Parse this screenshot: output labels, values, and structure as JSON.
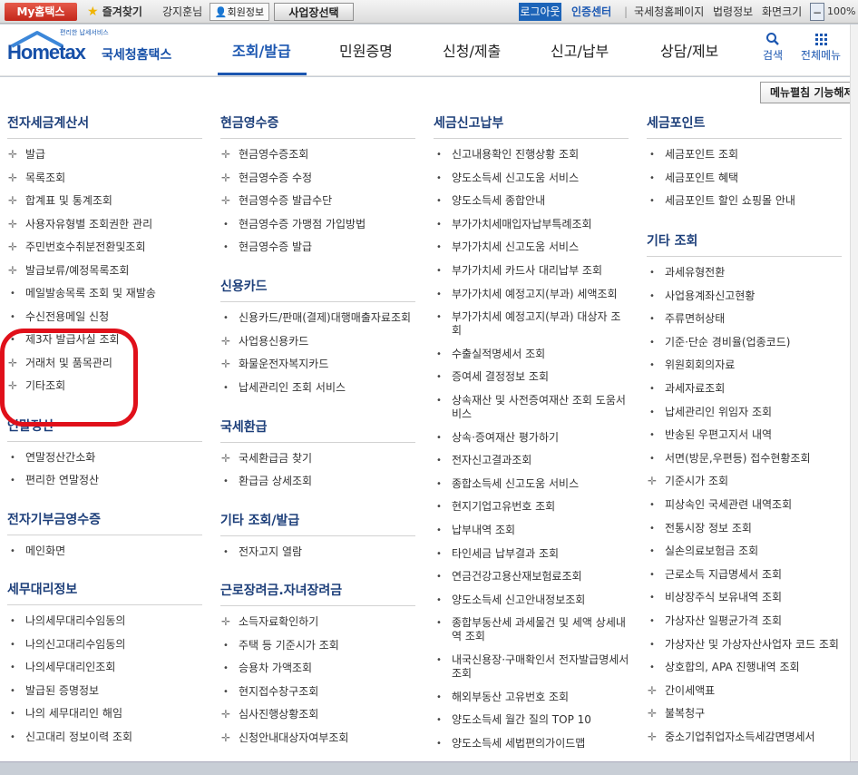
{
  "topbar": {
    "my_hometax": "My홈택스",
    "favorites": "즐겨찾기",
    "user_name": "강지훈님",
    "member_info": "회원정보",
    "business_select": "사업장선택",
    "logout": "로그아웃",
    "cert_center": "인증센터",
    "hometax_page": "국세청홈페이지",
    "law_info": "법령정보",
    "screen_size": "화면크기",
    "zoom_minus": "−",
    "zoom": "100%"
  },
  "header": {
    "logo_sub": "편리한 납세서비스",
    "logo_text": "Hometax",
    "logo_nts": "국세청홈택스",
    "gnb": [
      "조회/발급",
      "민원증명",
      "신청/제출",
      "신고/납부",
      "상담/제보"
    ],
    "active_gnb": "조회/발급",
    "search_label": "검색",
    "all_menu_label": "전체메뉴",
    "brand_color": "#1750a8"
  },
  "panel": {
    "collapse_label": "메뉴펼침 기능해제",
    "sections": [
      {
        "title": "전자세금계산서",
        "items": [
          {
            "label": "발급",
            "expand": true
          },
          {
            "label": "목록조회",
            "expand": true
          },
          {
            "label": "합계표 및 통계조회",
            "expand": true
          },
          {
            "label": "사용자유형별 조회권한 관리",
            "expand": true
          },
          {
            "label": "주민번호수취분전환및조회",
            "expand": true
          },
          {
            "label": "발급보류/예정목록조회",
            "expand": true
          },
          {
            "label": "메일발송목록 조회 및 재발송",
            "expand": false
          },
          {
            "label": "수신전용메일 신청",
            "expand": false
          },
          {
            "label": "제3자 발급사실 조회",
            "expand": false
          },
          {
            "label": "거래처 및 품목관리",
            "expand": true
          },
          {
            "label": "기타조회",
            "expand": true
          }
        ]
      },
      {
        "title": "연말정산",
        "items": [
          {
            "label": "연말정산간소화",
            "expand": false
          },
          {
            "label": "편리한 연말정산",
            "expand": false
          }
        ]
      },
      {
        "title": "전자기부금영수증",
        "items": [
          {
            "label": "메인화면",
            "expand": false
          }
        ]
      },
      {
        "title": "세무대리정보",
        "items": [
          {
            "label": "나의세무대리수임동의",
            "expand": false
          },
          {
            "label": "나의신고대리수임동의",
            "expand": false
          },
          {
            "label": "나의세무대리인조회",
            "expand": false
          },
          {
            "label": "발급된 증명정보",
            "expand": false
          },
          {
            "label": "나의 세무대리인 해임",
            "expand": false
          },
          {
            "label": "신고대리 정보이력 조회",
            "expand": false
          }
        ]
      },
      {
        "title": "현금영수증",
        "items": [
          {
            "label": "현금영수증조회",
            "expand": true
          },
          {
            "label": "현금영수증 수정",
            "expand": true
          },
          {
            "label": "현금영수증 발급수단",
            "expand": true
          },
          {
            "label": "현금영수증 가맹점 가입방법",
            "expand": false
          },
          {
            "label": "현금영수증 발급",
            "expand": false
          }
        ]
      },
      {
        "title": "신용카드",
        "items": [
          {
            "label": "신용카드/판매(결제)대행매출자료조회",
            "expand": false
          },
          {
            "label": "사업용신용카드",
            "expand": true
          },
          {
            "label": "화물운전자복지카드",
            "expand": true
          },
          {
            "label": "납세관리인 조회 서비스",
            "expand": false
          }
        ]
      },
      {
        "title": "국세환급",
        "items": [
          {
            "label": "국세환급금 찾기",
            "expand": true
          },
          {
            "label": "환급금 상세조회",
            "expand": false
          }
        ]
      },
      {
        "title": "기타 조회/발급",
        "items": [
          {
            "label": "전자고지 열람",
            "expand": false
          }
        ]
      },
      {
        "title": "근로장려금.자녀장려금",
        "items": [
          {
            "label": "소득자료확인하기",
            "expand": true
          },
          {
            "label": "주택 등 기준시가 조회",
            "expand": false
          },
          {
            "label": "승용차 가액조회",
            "expand": false
          },
          {
            "label": "현지접수창구조회",
            "expand": false
          },
          {
            "label": "심사진행상황조회",
            "expand": true
          },
          {
            "label": "신청안내대상자여부조회",
            "expand": true
          }
        ]
      },
      {
        "title": "세금신고납부",
        "items": [
          {
            "label": "신고내용확인 진행상황 조회",
            "expand": false
          },
          {
            "label": "양도소득세 신고도움 서비스",
            "expand": false
          },
          {
            "label": "양도소득세 종합안내",
            "expand": false
          },
          {
            "label": "부가가치세매입자납부특례조회",
            "expand": false
          },
          {
            "label": "부가가치세 신고도움 서비스",
            "expand": false
          },
          {
            "label": "부가가치세 카드사 대리납부 조회",
            "expand": false
          },
          {
            "label": "부가가치세 예정고지(부과) 세액조회",
            "expand": false
          },
          {
            "label": "부가가치세 예정고지(부과) 대상자 조회",
            "expand": false
          },
          {
            "label": "수출실적명세서 조회",
            "expand": false
          },
          {
            "label": "증여세 결정정보 조회",
            "expand": false
          },
          {
            "label": "상속재산 및 사전증여재산 조회 도움서비스",
            "expand": false
          },
          {
            "label": "상속·증여재산 평가하기",
            "expand": false
          },
          {
            "label": "전자신고결과조회",
            "expand": false
          },
          {
            "label": "종합소득세 신고도움 서비스",
            "expand": false
          },
          {
            "label": "현지기업고유번호 조회",
            "expand": false
          },
          {
            "label": "납부내역 조회",
            "expand": false
          },
          {
            "label": "타인세금 납부결과 조회",
            "expand": false
          },
          {
            "label": "연금건강고용산재보험료조회",
            "expand": false
          },
          {
            "label": "양도소득세 신고안내정보조회",
            "expand": false
          },
          {
            "label": "종합부동산세 과세물건 및 세액 상세내역 조회",
            "expand": false
          },
          {
            "label": "내국신용장·구매확인서 전자발급명세서 조회",
            "expand": false
          },
          {
            "label": "해외부동산 고유번호 조회",
            "expand": false
          },
          {
            "label": "양도소득세 월간 질의 TOP 10",
            "expand": false
          },
          {
            "label": "양도소득세 세법편의가이드맵",
            "expand": false
          }
        ]
      },
      {
        "title": "세금포인트",
        "items": [
          {
            "label": "세금포인트 조회",
            "expand": false
          },
          {
            "label": "세금포인트 혜택",
            "expand": false
          },
          {
            "label": "세금포인트 할인 쇼핑몰 안내",
            "expand": false
          }
        ]
      },
      {
        "title": "기타 조회",
        "items": [
          {
            "label": "과세유형전환",
            "expand": false
          },
          {
            "label": "사업용계좌신고현황",
            "expand": false
          },
          {
            "label": "주류면허상태",
            "expand": false
          },
          {
            "label": "기준·단순 경비율(업종코드)",
            "expand": false
          },
          {
            "label": "위원회회의자료",
            "expand": false
          },
          {
            "label": "과세자료조회",
            "expand": false
          },
          {
            "label": "납세관리인 위임자 조회",
            "expand": false
          },
          {
            "label": "반송된 우편고지서 내역",
            "expand": false
          },
          {
            "label": "서면(방문,우편등) 접수현황조회",
            "expand": false
          },
          {
            "label": "기준시가 조회",
            "expand": true
          },
          {
            "label": "피상속인 국세관련 내역조회",
            "expand": false
          },
          {
            "label": "전통시장 정보 조회",
            "expand": false
          },
          {
            "label": "실손의료보험금 조회",
            "expand": false
          },
          {
            "label": "근로소득 지급명세서 조회",
            "expand": false
          },
          {
            "label": "비상장주식 보유내역 조회",
            "expand": false
          },
          {
            "label": "가상자산 일평균가격 조회",
            "expand": false
          },
          {
            "label": "가상자산 및 가상자산사업자 코드 조회",
            "expand": false
          },
          {
            "label": "상호합의, APA 진행내역 조회",
            "expand": false
          },
          {
            "label": "간이세액표",
            "expand": true
          },
          {
            "label": "불복청구",
            "expand": true
          },
          {
            "label": "중소기업취업자소득세감면명세서",
            "expand": true
          }
        ]
      }
    ]
  }
}
